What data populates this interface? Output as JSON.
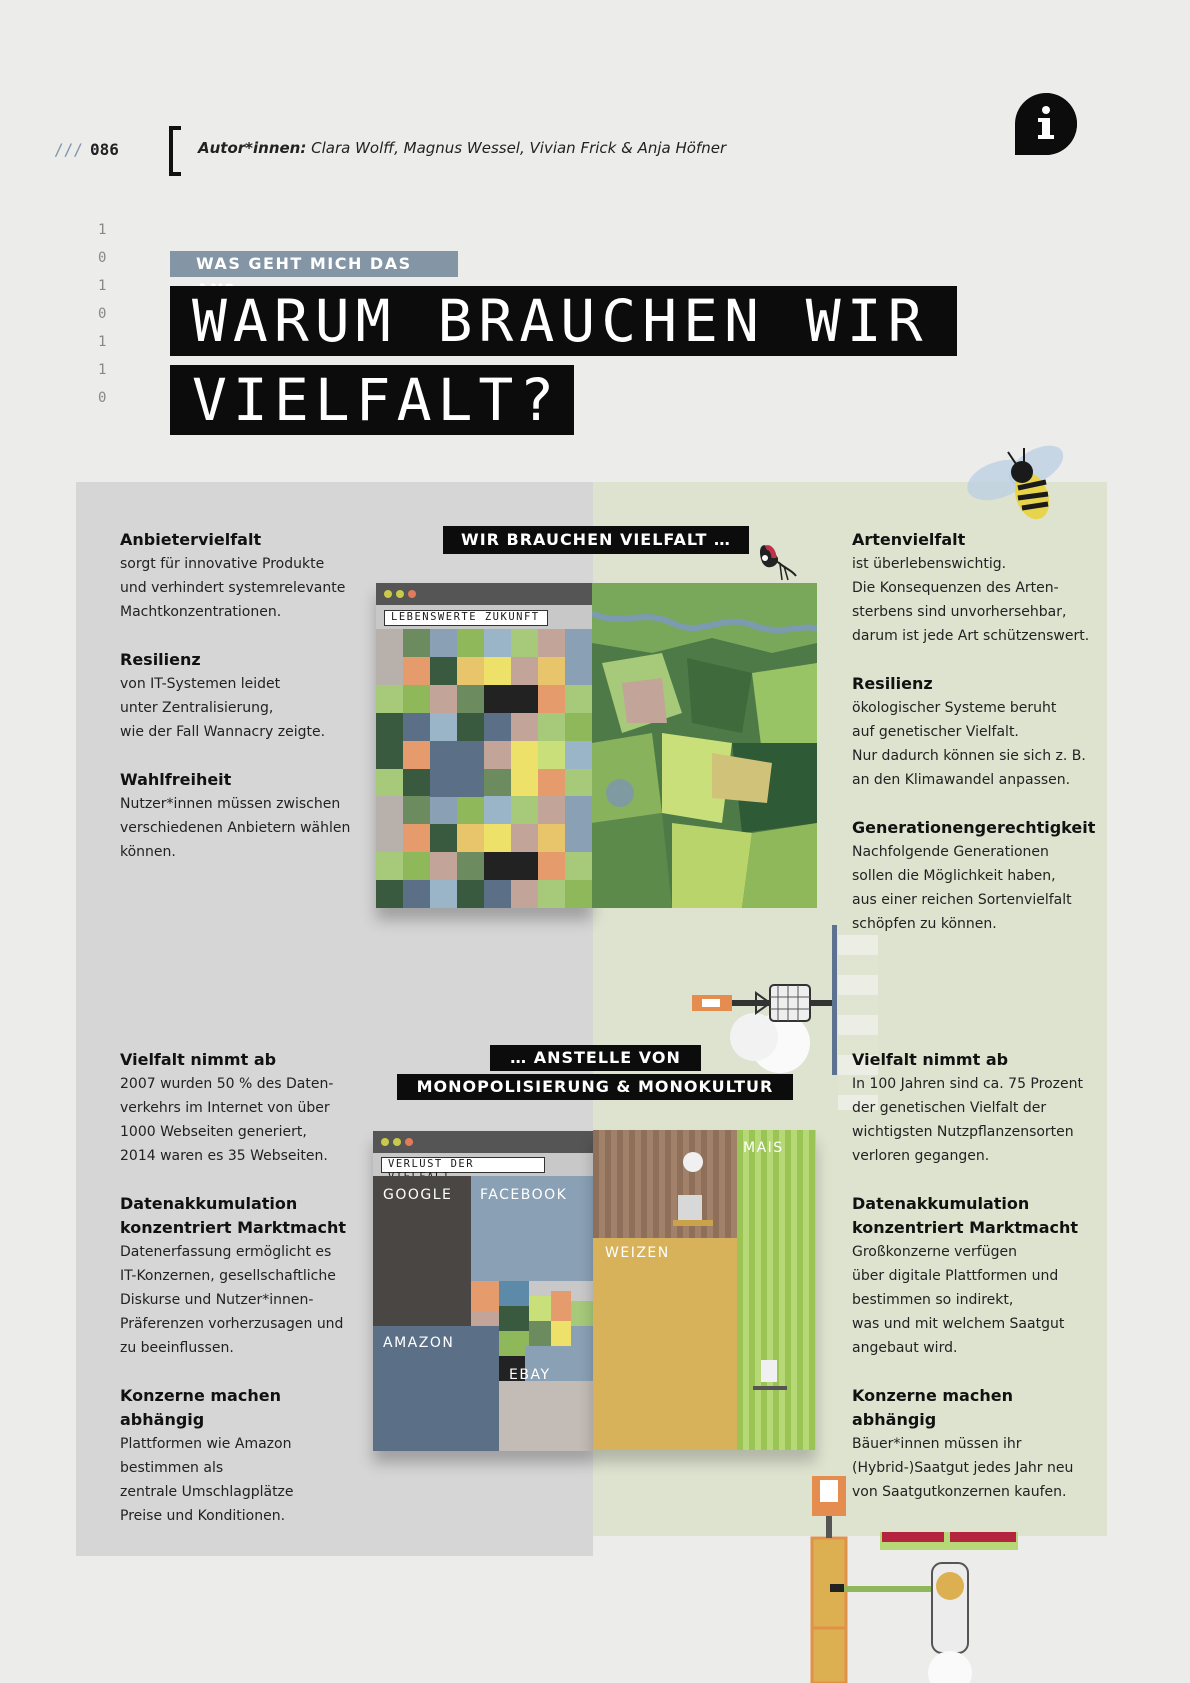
{
  "header": {
    "slashes": "///",
    "page_number": "086",
    "authors_label": "Autor*innen:",
    "authors": "Clara Wolff, Magnus Wessel, Vivian Frick & Anja Höfner",
    "info_icon": "info-bubble-icon"
  },
  "binary": [
    "1",
    "0",
    "1",
    "0",
    "1",
    "1",
    "0"
  ],
  "kicker": "WAS GEHT MICH DAS AN?",
  "title_line1": "WARUM BRAUCHEN WIR",
  "title_line2": "VIELFALT?",
  "labels": {
    "wir_brauchen": "WIR BRAUCHEN VIELFALT …",
    "anstelle_von": "… ANSTELLE VON",
    "monopolisierung": "MONOPOLISIERUNG & MONOKULTUR"
  },
  "left_top": [
    {
      "heading": "Anbietervielfalt",
      "body": "sorgt für innovative Produkte\nund verhindert systemrelevante\nMachtkonzentrationen."
    },
    {
      "heading": "Resilienz",
      "body": "von IT-Systemen leidet\nunter Zentralisierung,\nwie der Fall Wannacry zeigte."
    },
    {
      "heading": "Wahlfreiheit",
      "body": "Nutzer*innen müssen zwischen\nverschiedenen Anbietern wählen\nkönnen."
    }
  ],
  "right_top": [
    {
      "heading": "Artenvielfalt",
      "body": "ist überlebenswichtig.\nDie Konsequenzen des Arten-\nsterbens sind unvorhersehbar,\ndarum ist jede Art schützenswert."
    },
    {
      "heading": "Resilienz",
      "body": "ökologischer Systeme beruht\nauf genetischer Vielfalt.\nNur dadurch können sie sich z. B.\nan den Klimawandel anpassen."
    },
    {
      "heading": "Generationengerechtigkeit",
      "body": "Nachfolgende Generationen\nsollen die Möglichkeit haben,\naus einer reichen Sortenvielfalt\nschöpfen zu können."
    }
  ],
  "left_bottom": [
    {
      "heading": "Vielfalt nimmt ab",
      "body": "2007 wurden 50 % des Daten-\nverkehrs im Internet von über\n1000 Webseiten generiert,\n2014 waren es 35 Webseiten."
    },
    {
      "heading": "Datenakkumulation\nkonzentriert Marktmacht",
      "body": "Datenerfassung ermöglicht es\nIT-Konzernen,  gesellschaftliche\nDiskurse und Nutzer*innen-\nPräferenzen vorherzusagen und\nzu beeinflussen."
    },
    {
      "heading": "Konzerne machen abhängig",
      "body": "Plattformen wie Amazon\nbestimmen als\nzentrale Umschlagplätze\nPreise und Konditionen."
    }
  ],
  "right_bottom": [
    {
      "heading": "Vielfalt nimmt ab",
      "body": "In 100 Jahren sind ca. 75 Prozent\nder genetischen Vielfalt der\nwichtigsten Nutzpflanzensorten\nverloren gegangen."
    },
    {
      "heading": "Datenakkumulation\nkonzentriert Marktmacht",
      "body": "Großkonzerne verfügen\nüber digitale Plattformen und\nbestimmen so indirekt,\nwas und mit welchem Saatgut\nangebaut wird."
    },
    {
      "heading": "Konzerne machen abhängig",
      "body": "Bäuer*innen müssen ihr\n(Hybrid-)Saatgut jedes Jahr neu\nvon Saatgutkonzernen kaufen."
    }
  ],
  "window_top": {
    "url": "LEBENSWERTE ZUKUNFT"
  },
  "window_bottom": {
    "url": "VERLUST DER VIELFALT",
    "blocks": {
      "google": "GOOGLE",
      "facebook": "FACEBOOK",
      "amazon": "AMAZON",
      "ebay": "EBAY"
    },
    "fields": {
      "mais": "MAIS",
      "weizen": "WEIZEN"
    }
  },
  "colors": {
    "panel_left": "#d6d6d6",
    "panel_right": "#dde3cf",
    "kicker_bg": "#8496a6",
    "title_bg": "#0c0c0c",
    "google": "#4a4644",
    "facebook": "#8aa0b5",
    "amazon": "#5b7087",
    "ebay": "#c3bbb5",
    "weizen": "#d8b25a",
    "mais": "#9ac554"
  }
}
